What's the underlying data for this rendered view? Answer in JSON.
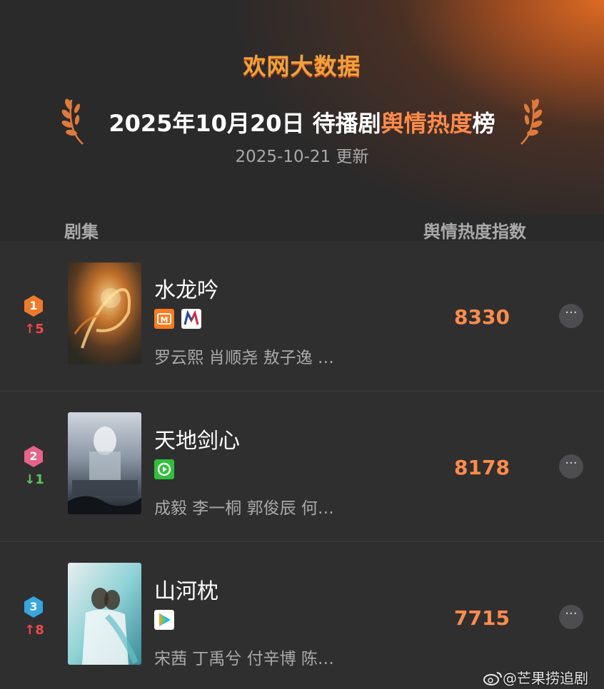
{
  "header": {
    "brand": "欢网大数据",
    "title_prefix": "2025年10月20日 待播剧",
    "title_highlight": "舆情热度",
    "title_suffix": "榜",
    "updated": "2025-10-21 更新"
  },
  "columns": {
    "left": "剧集",
    "right": "舆情热度指数"
  },
  "dramas": [
    {
      "rank": "1",
      "change": "↑5",
      "change_dir": "up",
      "title": "水龙吟",
      "cast": "罗云熙 肖顺尧 敖子逸 …",
      "score": "8330",
      "platforms": [
        "mango-tv-icon",
        "migu-icon"
      ]
    },
    {
      "rank": "2",
      "change": "↓1",
      "change_dir": "down",
      "title": "天地剑心",
      "cast": "成毅 李一桐 郭俊辰 何…",
      "score": "8178",
      "platforms": [
        "iqiyi-icon"
      ]
    },
    {
      "rank": "3",
      "change": "↑8",
      "change_dir": "up",
      "title": "山河枕",
      "cast": "宋茜 丁禹兮 付辛博 陈…",
      "score": "7715",
      "platforms": [
        "tencent-video-icon"
      ]
    }
  ],
  "more_label": "···",
  "watermark": "@芒果捞追剧",
  "colors": {
    "accent": "#ff8c4a",
    "rank1": "#f07a2c",
    "rank2": "#e8628a",
    "rank3": "#36a6e0",
    "up": "#f04848",
    "down": "#5cc65c"
  }
}
